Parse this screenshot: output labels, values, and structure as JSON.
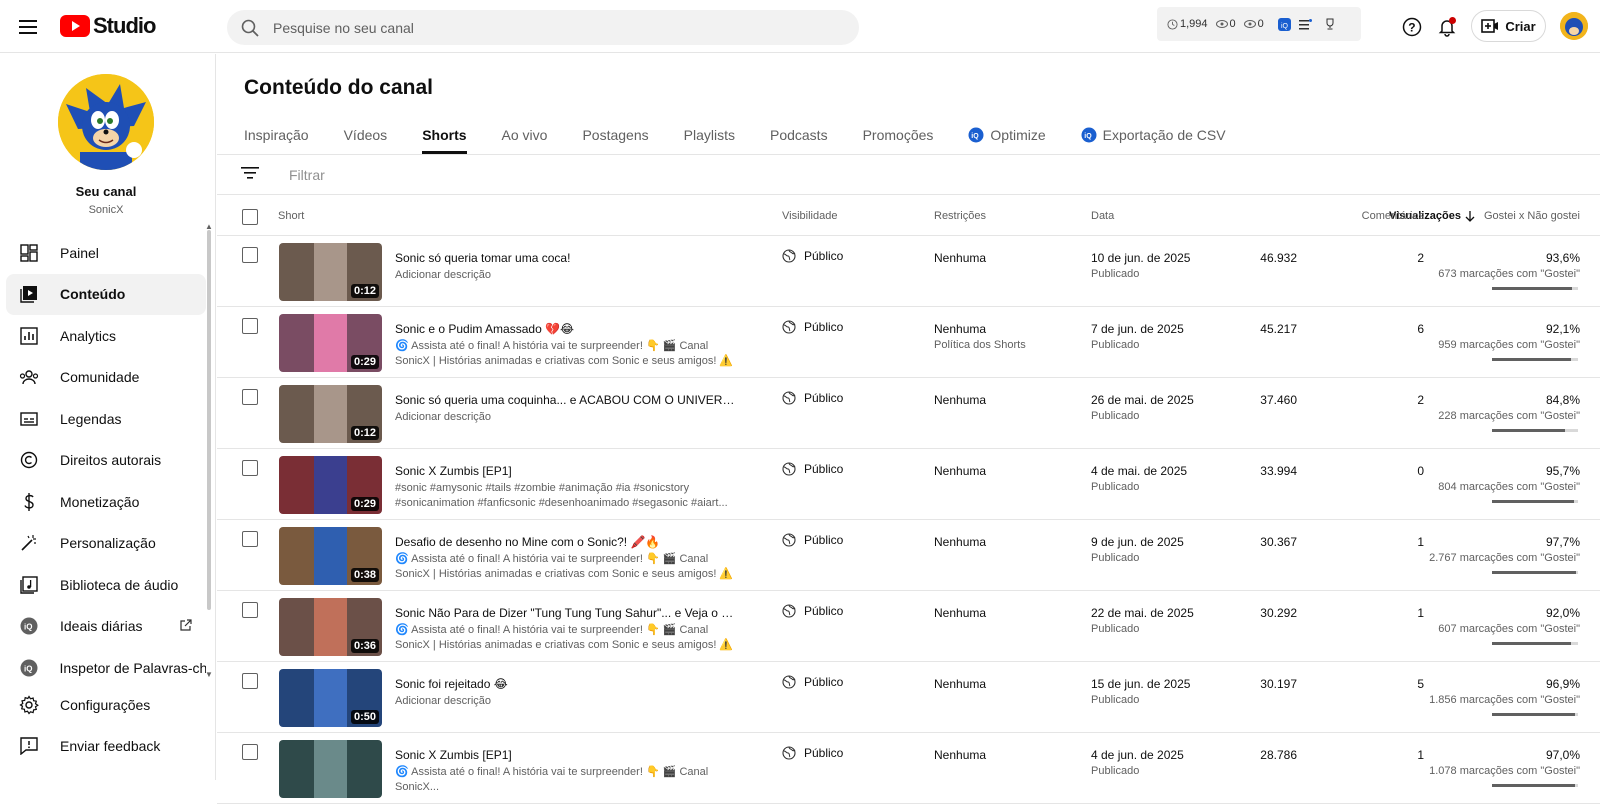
{
  "header": {
    "logo_text": "Studio",
    "search_placeholder": "Pesquise no seu canal",
    "stats": {
      "watch_hours": "1,994",
      "views": "0",
      "realtime": "0"
    },
    "create_label": "Criar"
  },
  "sidebar": {
    "channel_title": "Seu canal",
    "channel_name": "SonicX",
    "items": [
      {
        "label": "Painel",
        "icon": "dashboard-icon"
      },
      {
        "label": "Conteúdo",
        "icon": "content-icon",
        "active": true
      },
      {
        "label": "Analytics",
        "icon": "analytics-icon"
      },
      {
        "label": "Comunidade",
        "icon": "community-icon"
      },
      {
        "label": "Legendas",
        "icon": "subtitles-icon"
      },
      {
        "label": "Direitos autorais",
        "icon": "copyright-icon"
      },
      {
        "label": "Monetização",
        "icon": "dollar-icon"
      },
      {
        "label": "Personalização",
        "icon": "magic-wand-icon"
      },
      {
        "label": "Biblioteca de áudio",
        "icon": "audio-library-icon"
      },
      {
        "label": "Ideais diárias",
        "icon": "vidiq-icon"
      },
      {
        "label": "Inspetor de Palavras-chav",
        "icon": "vidiq-icon"
      }
    ],
    "bottom_items": [
      {
        "label": "Configurações",
        "icon": "gear-icon"
      },
      {
        "label": "Enviar feedback",
        "icon": "feedback-icon"
      }
    ]
  },
  "main": {
    "title": "Conteúdo do canal",
    "tabs": [
      "Inspiração",
      "Vídeos",
      "Shorts",
      "Ao vivo",
      "Postagens",
      "Playlists",
      "Podcasts",
      "Promoções",
      "Optimize",
      "Exportação de CSV"
    ],
    "active_tab": "Shorts",
    "filter_placeholder": "Filtrar",
    "columns": {
      "short": "Short",
      "visibility": "Visibilidade",
      "restrictions": "Restrições",
      "date": "Data",
      "views": "Visualizações",
      "comments": "Comentários",
      "likes": "Gostei x Não gostei"
    },
    "rows": [
      {
        "title": "Sonic só queria tomar uma coca!",
        "desc": "Adicionar descrição",
        "duration": "0:12",
        "visibility": "Público",
        "restriction": "Nenhuma",
        "restriction2": "",
        "date": "10 de jun. de 2025",
        "status": "Publicado",
        "views": "46.932",
        "comments": "2",
        "like_pct": "93,6%",
        "likes": "673 marcações com \"Gostei\"",
        "like_ratio": 0.936,
        "thumb_bg": "#6b5a4e",
        "thumb_inner": "#a8968a"
      },
      {
        "title": "Sonic e o Pudim Amassado 💔😂",
        "desc": "🌀 Assista até o final! A história vai te surpreender! 👇 🎬 Canal SonicX | Histórias animadas e criativas com Sonic e seus amigos! ⚠️ Todos os...",
        "duration": "0:29",
        "visibility": "Público",
        "restriction": "Nenhuma",
        "restriction2": "Política dos Shorts",
        "date": "7 de jun. de 2025",
        "status": "Publicado",
        "views": "45.217",
        "comments": "6",
        "like_pct": "92,1%",
        "likes": "959 marcações com \"Gostei\"",
        "like_ratio": 0.921,
        "thumb_bg": "#7a4c63",
        "thumb_inner": "#e07aa8"
      },
      {
        "title": "Sonic só queria uma coquinha... e ACABOU COM O UNIVERSO! 🥤💥",
        "desc": "Adicionar descrição",
        "duration": "0:12",
        "visibility": "Público",
        "restriction": "Nenhuma",
        "restriction2": "",
        "date": "26 de mai. de 2025",
        "status": "Publicado",
        "views": "37.460",
        "comments": "2",
        "like_pct": "84,8%",
        "likes": "228 marcações com \"Gostei\"",
        "like_ratio": 0.848,
        "thumb_bg": "#6b5a4e",
        "thumb_inner": "#a8968a"
      },
      {
        "title": "Sonic X Zumbis [EP1]",
        "desc": "#sonic #amysonic #tails #zombie #animação #ia #sonicstory #sonicanimation #fanficsonic #desenhoanimado #segasonic #aiart...",
        "duration": "0:29",
        "visibility": "Público",
        "restriction": "Nenhuma",
        "restriction2": "",
        "date": "4 de mai. de 2025",
        "status": "Publicado",
        "views": "33.994",
        "comments": "0",
        "like_pct": "95,7%",
        "likes": "804 marcações com \"Gostei\"",
        "like_ratio": 0.957,
        "thumb_bg": "#7a2e35",
        "thumb_inner": "#3b3f8f"
      },
      {
        "title": "Desafio de desenho no Mine com o Sonic?! 🖍️🔥",
        "desc": "🌀 Assista até o final! A história vai te surpreender! 👇 🎬 Canal SonicX | Histórias animadas e criativas com Sonic e seus amigos! ⚠️ Todos os...",
        "duration": "0:38",
        "visibility": "Público",
        "restriction": "Nenhuma",
        "restriction2": "",
        "date": "9 de jun. de 2025",
        "status": "Publicado",
        "views": "30.367",
        "comments": "1",
        "like_pct": "97,7%",
        "likes": "2.767 marcações com \"Gostei\"",
        "like_ratio": 0.977,
        "thumb_bg": "#7a5a3e",
        "thumb_inner": "#2f5fb0"
      },
      {
        "title": "Sonic Não Para de Dizer \"Tung Tung Tung Sahur\"... e Veja o Que a Amy Fez!",
        "desc": "🌀 Assista até o final! A história vai te surpreender! 👇 🎬 Canal SonicX | Histórias animadas e criativas com Sonic e seus amigos! ⚠️ Todos os...",
        "duration": "0:36",
        "visibility": "Público",
        "restriction": "Nenhuma",
        "restriction2": "",
        "date": "22 de mai. de 2025",
        "status": "Publicado",
        "views": "30.292",
        "comments": "1",
        "like_pct": "92,0%",
        "likes": "607 marcações com \"Gostei\"",
        "like_ratio": 0.92,
        "thumb_bg": "#6b5048",
        "thumb_inner": "#c0705a"
      },
      {
        "title": "Sonic foi rejeitado 😂",
        "desc": "Adicionar descrição",
        "duration": "0:50",
        "visibility": "Público",
        "restriction": "Nenhuma",
        "restriction2": "",
        "date": "15 de jun. de 2025",
        "status": "Publicado",
        "views": "30.197",
        "comments": "5",
        "like_pct": "96,9%",
        "likes": "1.856 marcações com \"Gostei\"",
        "like_ratio": 0.969,
        "thumb_bg": "#24457a",
        "thumb_inner": "#3f6fc0"
      },
      {
        "title": "Sonic X Zumbis [EP1]",
        "desc": "🌀 Assista até o final! A história vai te surpreender! 👇 🎬 Canal SonicX...",
        "duration": "",
        "visibility": "Público",
        "restriction": "Nenhuma",
        "restriction2": "",
        "date": "4 de jun. de 2025",
        "status": "Publicado",
        "views": "28.786",
        "comments": "1",
        "like_pct": "97,0%",
        "likes": "1.078 marcações com \"Gostei\"",
        "like_ratio": 0.97,
        "thumb_bg": "#2f4a4a",
        "thumb_inner": "#6a8a8a"
      }
    ]
  }
}
